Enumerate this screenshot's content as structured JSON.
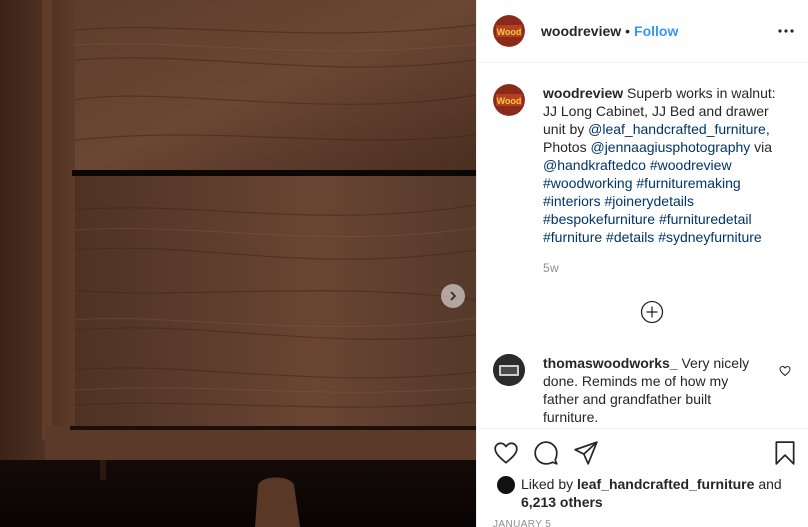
{
  "post": {
    "username": "woodreview",
    "separator": "•",
    "follow_label": "Follow",
    "avatar_text": "Wood"
  },
  "caption": {
    "username": "woodreview",
    "text_1": "Superb works in walnut: JJ Long Cabinet, JJ Bed and drawer unit by",
    "mention_1": "@leaf_handcrafted_furniture",
    "text_2": ", Photos",
    "mention_2": "@jennaagiusphotography",
    "text_3": "via",
    "mention_3": "@handkraftedco",
    "hashtags": [
      "#woodreview",
      "#woodworking",
      "#furnituremaking",
      "#interiors",
      "#joinerydetails",
      "#bespokefurniture",
      "#furnituredetail",
      "#furniture",
      "#details",
      "#sydneyfurniture"
    ],
    "time": "5w"
  },
  "comment": {
    "username": "thomaswoodworks_",
    "text": "Very nicely done. Reminds me of how my father and grandfather built furniture."
  },
  "likes": {
    "prefix": "Liked by",
    "user": "leaf_handcrafted_furniture",
    "conj": "and",
    "others": "6,213 others"
  },
  "date": "JANUARY 5",
  "icons": {
    "next": "chevron-right-icon",
    "more": "more-horizontal-icon",
    "load_more": "plus-circle-icon",
    "like": "heart-icon",
    "comment": "comment-icon",
    "share": "share-icon",
    "save": "bookmark-icon"
  },
  "colors": {
    "link": "#3897f0",
    "mention": "#003569",
    "muted": "#8e8e8e",
    "wood_dark": "#3b2418",
    "wood_mid": "#5a3a29"
  }
}
